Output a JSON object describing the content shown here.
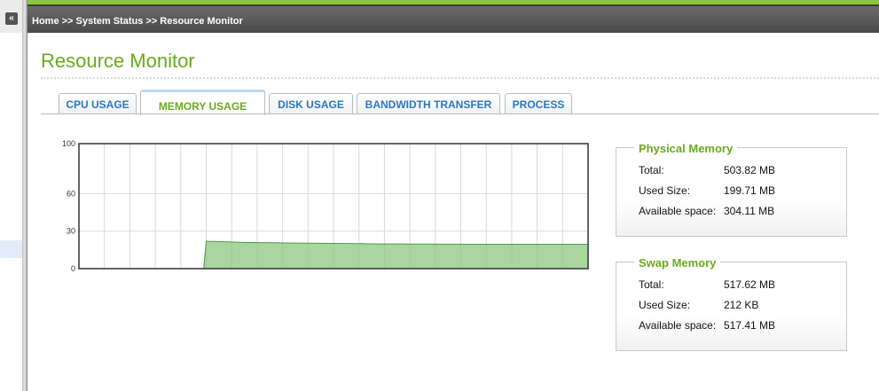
{
  "breadcrumb": "Home >> System Status >> Resource Monitor",
  "collapse_glyph": "«",
  "page_title": "Resource Monitor",
  "tabs": [
    {
      "label": "CPU USAGE",
      "active": false
    },
    {
      "label": "MEMORY USAGE",
      "active": true
    },
    {
      "label": "DISK USAGE",
      "active": false
    },
    {
      "label": "BANDWIDTH TRANSFER",
      "active": false
    },
    {
      "label": "PROCESS",
      "active": false
    }
  ],
  "chart_data": {
    "type": "area",
    "yticks": [
      "100",
      "60",
      "30",
      "0"
    ],
    "ylim": [
      0,
      100
    ],
    "grid": true,
    "series": [
      {
        "color": "#8cc77f",
        "values": [
          0,
          0,
          0,
          0,
          0,
          0,
          0,
          0,
          0,
          0,
          0,
          0,
          0,
          0,
          0,
          0,
          0,
          0,
          0,
          0,
          0,
          0,
          0,
          0,
          0,
          0,
          0,
          0,
          0,
          0,
          0,
          0,
          0,
          0,
          0,
          0,
          0,
          0,
          0,
          0,
          0,
          0,
          0,
          0,
          0,
          0,
          0,
          0,
          0,
          0,
          0,
          22,
          21.8,
          21.8,
          21.8,
          21.7,
          21.7,
          21.6,
          21.6,
          21.5,
          21.5,
          21.4,
          21.3,
          21.2,
          21.1,
          21.0,
          21.0,
          20.9,
          20.9,
          20.9,
          20.9,
          20.8,
          20.8,
          20.8,
          20.8,
          20.8,
          20.7,
          20.7,
          20.7,
          20.7,
          20.7,
          20.6,
          20.6,
          20.6,
          20.6,
          20.5,
          20.5,
          20.5,
          20.5,
          20.5,
          20.4,
          20.4,
          20.4,
          20.4,
          20.4,
          20.3,
          20.3,
          20.3,
          20.3,
          20.3,
          20.2,
          20.2,
          20.2,
          20.2,
          20.2,
          20.1,
          20.1,
          20.1,
          20.1,
          20.1,
          20.0,
          20.0,
          20.0,
          20.0,
          20.0,
          19.9,
          19.9,
          19.9,
          19.9,
          19.9,
          19.8,
          19.8,
          19.8,
          19.8,
          19.8,
          19.8,
          19.8,
          19.8,
          19.8,
          19.8,
          19.8,
          19.7,
          19.7,
          19.7,
          19.7,
          19.7,
          19.7,
          19.7,
          19.7,
          19.7,
          19.7,
          19.7,
          19.6,
          19.6,
          19.6,
          19.6,
          19.6,
          19.6,
          19.6,
          19.6,
          19.6,
          19.6,
          19.6,
          19.5,
          19.5,
          19.5,
          19.5,
          19.5,
          19.5,
          19.5,
          19.5,
          19.5,
          19.5,
          19.5,
          19.5,
          19.5,
          19.5,
          19.5,
          19.5,
          19.5,
          19.5,
          19.5,
          19.5,
          19.5,
          19.5,
          19.5,
          19.5,
          19.5,
          19.5,
          19.5,
          19.5,
          19.5,
          19.5,
          19.5,
          19.5,
          19.5,
          19.5,
          19.5,
          19.5,
          19.5,
          19.5,
          19.5,
          19.5,
          19.5,
          19.5,
          19.5,
          19.5,
          19.5,
          19.5,
          19.5,
          19.5,
          19.5,
          19.5,
          19.5,
          19.5
        ]
      }
    ]
  },
  "physical_memory": {
    "title": "Physical Memory",
    "rows": [
      {
        "label": "Total:",
        "value": "503.82 MB"
      },
      {
        "label": "Used Size:",
        "value": "199.71 MB"
      },
      {
        "label": "Available space:",
        "value": "304.11 MB"
      }
    ]
  },
  "swap_memory": {
    "title": "Swap Memory",
    "rows": [
      {
        "label": "Total:",
        "value": "517.62 MB"
      },
      {
        "label": "Used Size:",
        "value": "212 KB"
      },
      {
        "label": "Available space:",
        "value": "517.41 MB"
      }
    ]
  },
  "colors": {
    "accent_green": "#6aaa1e",
    "tab_blue": "#2a78bf",
    "header_green": "#8cc63f"
  }
}
